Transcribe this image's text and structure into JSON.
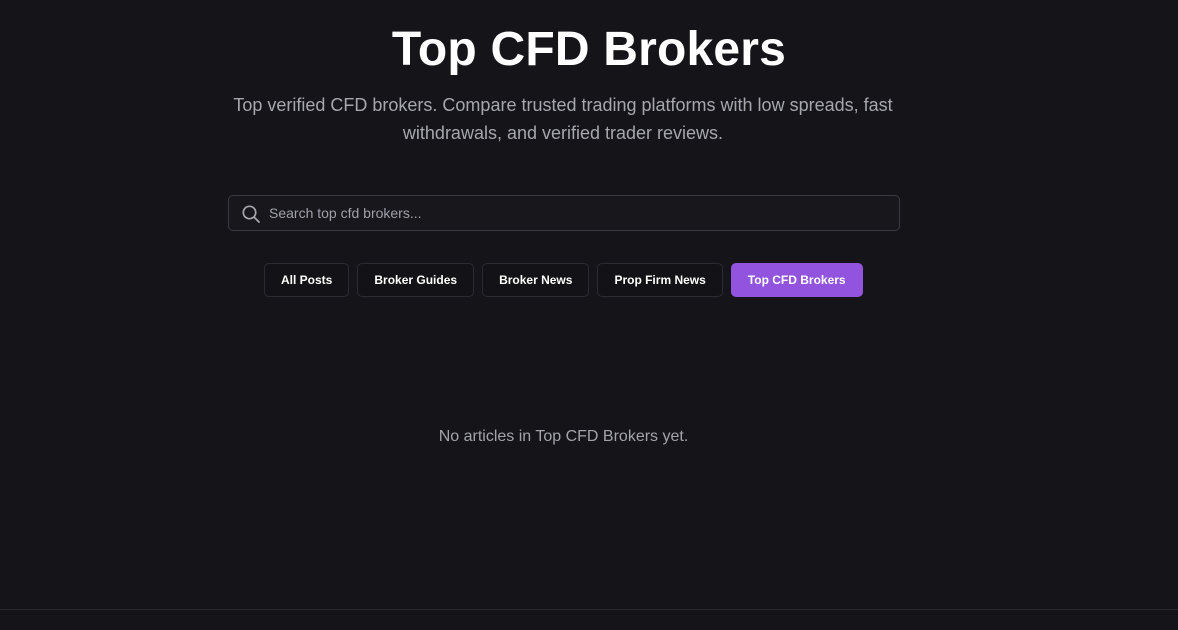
{
  "header": {
    "title": "Top CFD Brokers",
    "subtitle": "Top verified CFD brokers. Compare trusted trading platforms with low spreads, fast withdrawals, and verified trader reviews."
  },
  "search": {
    "value": "",
    "placeholder": "Search top cfd brokers...",
    "icon": "search-icon"
  },
  "filters": [
    {
      "label": "All Posts",
      "active": false
    },
    {
      "label": "Broker Guides",
      "active": false
    },
    {
      "label": "Broker News",
      "active": false
    },
    {
      "label": "Prop Firm News",
      "active": false
    },
    {
      "label": "Top CFD Brokers",
      "active": true
    }
  ],
  "empty_state": {
    "message": "No articles in Top CFD Brokers yet."
  },
  "colors": {
    "background": "#151519",
    "accent": "#9254de",
    "text_primary": "#ffffff",
    "text_muted": "#a6a6ae"
  }
}
